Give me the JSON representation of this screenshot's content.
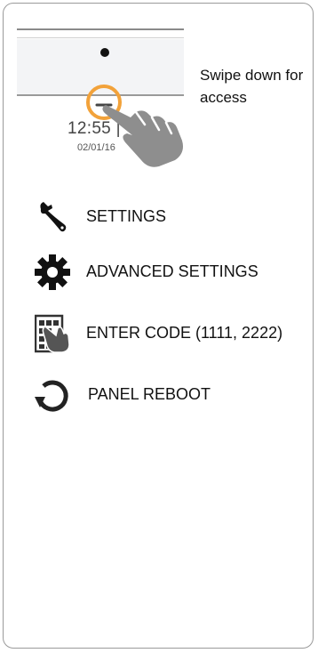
{
  "illustration": {
    "time": "12:55 |",
    "date": "02/01/16",
    "instruction": "Swipe down for access",
    "accent_color": "#f2a23a"
  },
  "menu": {
    "items": [
      {
        "label": "SETTINGS",
        "icon": "wrench-icon"
      },
      {
        "label": "ADVANCED SETTINGS",
        "icon": "gear-icon"
      },
      {
        "label": "ENTER CODE (1111, 2222)",
        "icon": "keypad-hand-icon"
      },
      {
        "label": "PANEL REBOOT",
        "icon": "reboot-icon"
      }
    ]
  }
}
